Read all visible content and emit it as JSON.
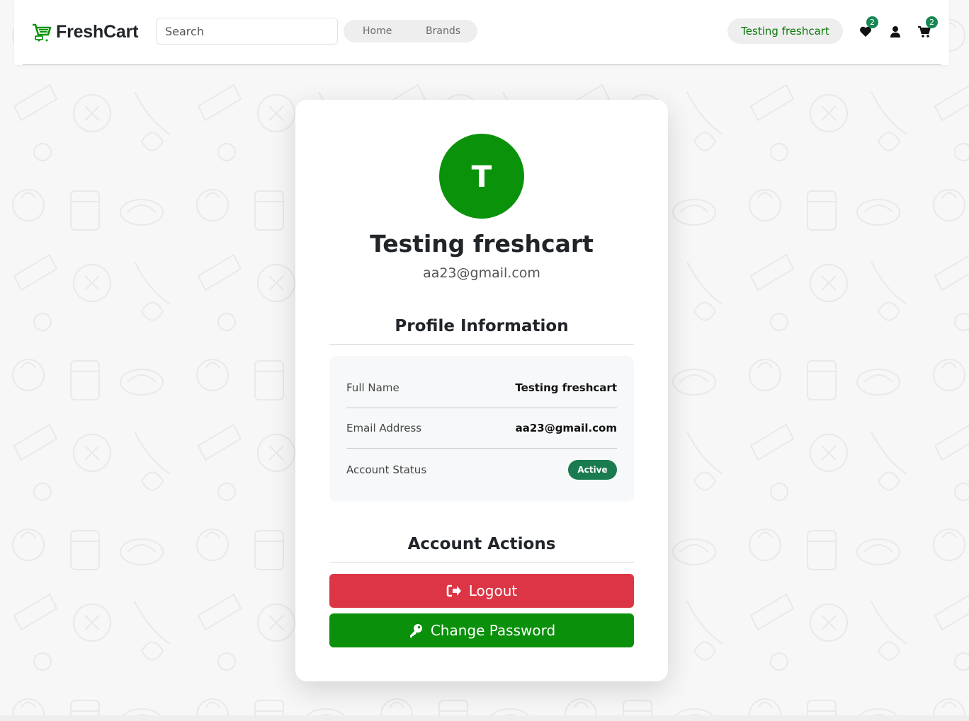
{
  "navbar": {
    "brand": "FreshCart",
    "search_placeholder": "Search",
    "links": [
      "Home",
      "Brands"
    ],
    "user_name": "Testing freshcart",
    "wishlist_count": "2",
    "cart_count": "2"
  },
  "profile": {
    "avatar_initial": "T",
    "name": "Testing freshcart",
    "email": "aa23@gmail.com"
  },
  "profile_info": {
    "title": "Profile Information",
    "rows": [
      {
        "label": "Full Name",
        "value": "Testing freshcart"
      },
      {
        "label": "Email Address",
        "value": "aa23@gmail.com"
      },
      {
        "label": "Account Status",
        "value": "Active"
      }
    ]
  },
  "account_actions": {
    "title": "Account Actions",
    "logout_label": "Logout",
    "change_password_label": "Change Password"
  },
  "colors": {
    "brand_green": "#0a930a",
    "danger": "#dc3545",
    "badge_green": "#198754"
  }
}
